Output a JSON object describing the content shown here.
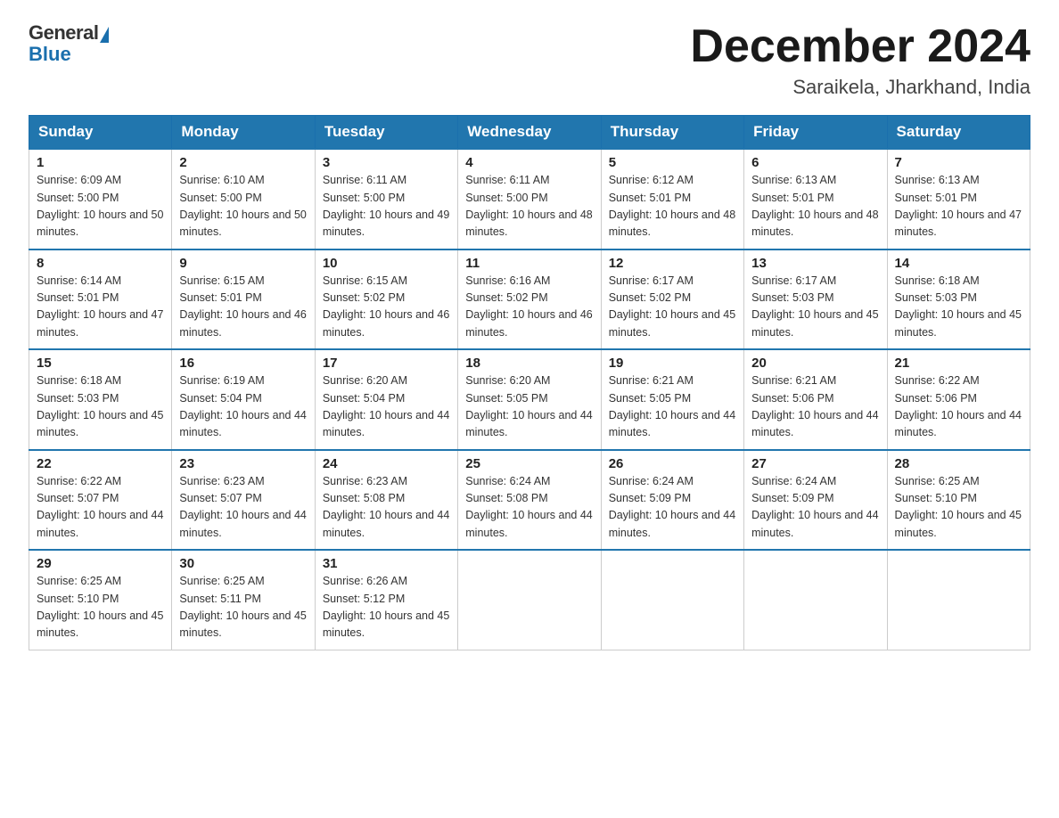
{
  "header": {
    "logo_general": "General",
    "logo_blue": "Blue",
    "month_title": "December 2024",
    "location": "Saraikela, Jharkhand, India"
  },
  "days_of_week": [
    "Sunday",
    "Monday",
    "Tuesday",
    "Wednesday",
    "Thursday",
    "Friday",
    "Saturday"
  ],
  "weeks": [
    [
      {
        "day": "1",
        "sunrise": "6:09 AM",
        "sunset": "5:00 PM",
        "daylight": "10 hours and 50 minutes."
      },
      {
        "day": "2",
        "sunrise": "6:10 AM",
        "sunset": "5:00 PM",
        "daylight": "10 hours and 50 minutes."
      },
      {
        "day": "3",
        "sunrise": "6:11 AM",
        "sunset": "5:00 PM",
        "daylight": "10 hours and 49 minutes."
      },
      {
        "day": "4",
        "sunrise": "6:11 AM",
        "sunset": "5:00 PM",
        "daylight": "10 hours and 48 minutes."
      },
      {
        "day": "5",
        "sunrise": "6:12 AM",
        "sunset": "5:01 PM",
        "daylight": "10 hours and 48 minutes."
      },
      {
        "day": "6",
        "sunrise": "6:13 AM",
        "sunset": "5:01 PM",
        "daylight": "10 hours and 48 minutes."
      },
      {
        "day": "7",
        "sunrise": "6:13 AM",
        "sunset": "5:01 PM",
        "daylight": "10 hours and 47 minutes."
      }
    ],
    [
      {
        "day": "8",
        "sunrise": "6:14 AM",
        "sunset": "5:01 PM",
        "daylight": "10 hours and 47 minutes."
      },
      {
        "day": "9",
        "sunrise": "6:15 AM",
        "sunset": "5:01 PM",
        "daylight": "10 hours and 46 minutes."
      },
      {
        "day": "10",
        "sunrise": "6:15 AM",
        "sunset": "5:02 PM",
        "daylight": "10 hours and 46 minutes."
      },
      {
        "day": "11",
        "sunrise": "6:16 AM",
        "sunset": "5:02 PM",
        "daylight": "10 hours and 46 minutes."
      },
      {
        "day": "12",
        "sunrise": "6:17 AM",
        "sunset": "5:02 PM",
        "daylight": "10 hours and 45 minutes."
      },
      {
        "day": "13",
        "sunrise": "6:17 AM",
        "sunset": "5:03 PM",
        "daylight": "10 hours and 45 minutes."
      },
      {
        "day": "14",
        "sunrise": "6:18 AM",
        "sunset": "5:03 PM",
        "daylight": "10 hours and 45 minutes."
      }
    ],
    [
      {
        "day": "15",
        "sunrise": "6:18 AM",
        "sunset": "5:03 PM",
        "daylight": "10 hours and 45 minutes."
      },
      {
        "day": "16",
        "sunrise": "6:19 AM",
        "sunset": "5:04 PM",
        "daylight": "10 hours and 44 minutes."
      },
      {
        "day": "17",
        "sunrise": "6:20 AM",
        "sunset": "5:04 PM",
        "daylight": "10 hours and 44 minutes."
      },
      {
        "day": "18",
        "sunrise": "6:20 AM",
        "sunset": "5:05 PM",
        "daylight": "10 hours and 44 minutes."
      },
      {
        "day": "19",
        "sunrise": "6:21 AM",
        "sunset": "5:05 PM",
        "daylight": "10 hours and 44 minutes."
      },
      {
        "day": "20",
        "sunrise": "6:21 AM",
        "sunset": "5:06 PM",
        "daylight": "10 hours and 44 minutes."
      },
      {
        "day": "21",
        "sunrise": "6:22 AM",
        "sunset": "5:06 PM",
        "daylight": "10 hours and 44 minutes."
      }
    ],
    [
      {
        "day": "22",
        "sunrise": "6:22 AM",
        "sunset": "5:07 PM",
        "daylight": "10 hours and 44 minutes."
      },
      {
        "day": "23",
        "sunrise": "6:23 AM",
        "sunset": "5:07 PM",
        "daylight": "10 hours and 44 minutes."
      },
      {
        "day": "24",
        "sunrise": "6:23 AM",
        "sunset": "5:08 PM",
        "daylight": "10 hours and 44 minutes."
      },
      {
        "day": "25",
        "sunrise": "6:24 AM",
        "sunset": "5:08 PM",
        "daylight": "10 hours and 44 minutes."
      },
      {
        "day": "26",
        "sunrise": "6:24 AM",
        "sunset": "5:09 PM",
        "daylight": "10 hours and 44 minutes."
      },
      {
        "day": "27",
        "sunrise": "6:24 AM",
        "sunset": "5:09 PM",
        "daylight": "10 hours and 44 minutes."
      },
      {
        "day": "28",
        "sunrise": "6:25 AM",
        "sunset": "5:10 PM",
        "daylight": "10 hours and 45 minutes."
      }
    ],
    [
      {
        "day": "29",
        "sunrise": "6:25 AM",
        "sunset": "5:10 PM",
        "daylight": "10 hours and 45 minutes."
      },
      {
        "day": "30",
        "sunrise": "6:25 AM",
        "sunset": "5:11 PM",
        "daylight": "10 hours and 45 minutes."
      },
      {
        "day": "31",
        "sunrise": "6:26 AM",
        "sunset": "5:12 PM",
        "daylight": "10 hours and 45 minutes."
      },
      null,
      null,
      null,
      null
    ]
  ]
}
